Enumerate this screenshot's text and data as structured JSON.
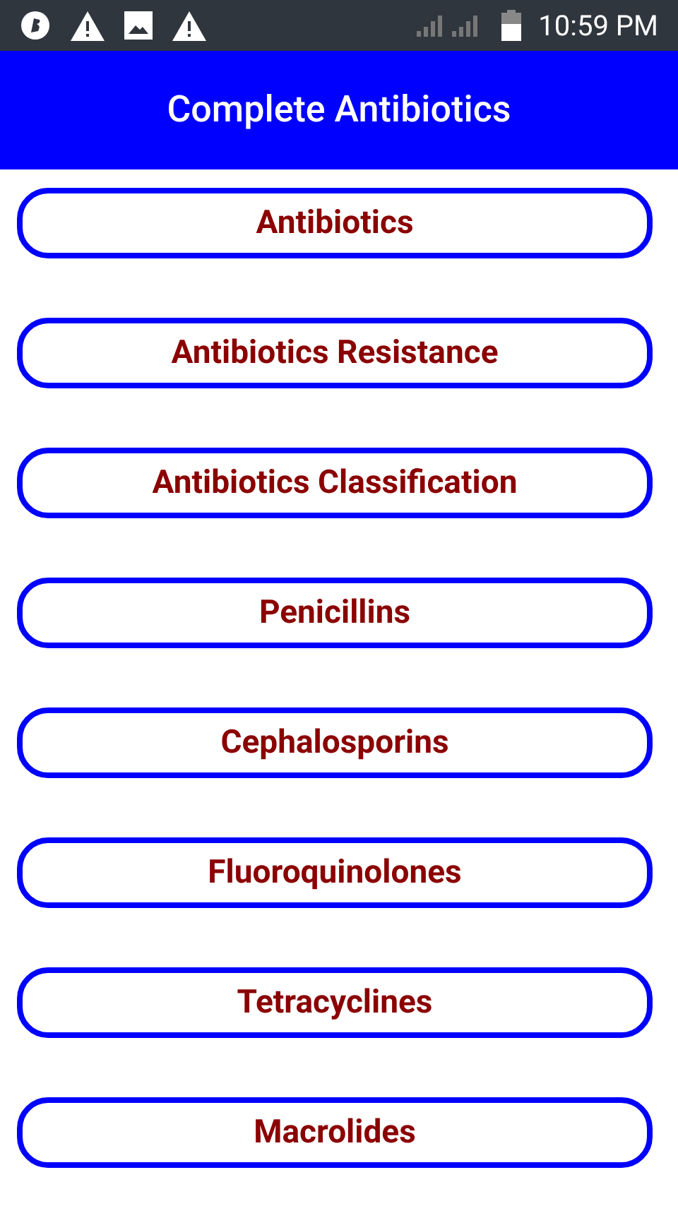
{
  "status_bar": {
    "time": "10:59 PM"
  },
  "app_bar": {
    "title": "Complete Antibiotics"
  },
  "menu": [
    {
      "label": "Antibiotics"
    },
    {
      "label": "Antibiotics Resistance"
    },
    {
      "label": "Antibiotics Classification"
    },
    {
      "label": "Penicillins"
    },
    {
      "label": "Cephalosporins"
    },
    {
      "label": "Fluoroquinolones"
    },
    {
      "label": "Tetracyclines"
    },
    {
      "label": "Macrolides"
    }
  ]
}
